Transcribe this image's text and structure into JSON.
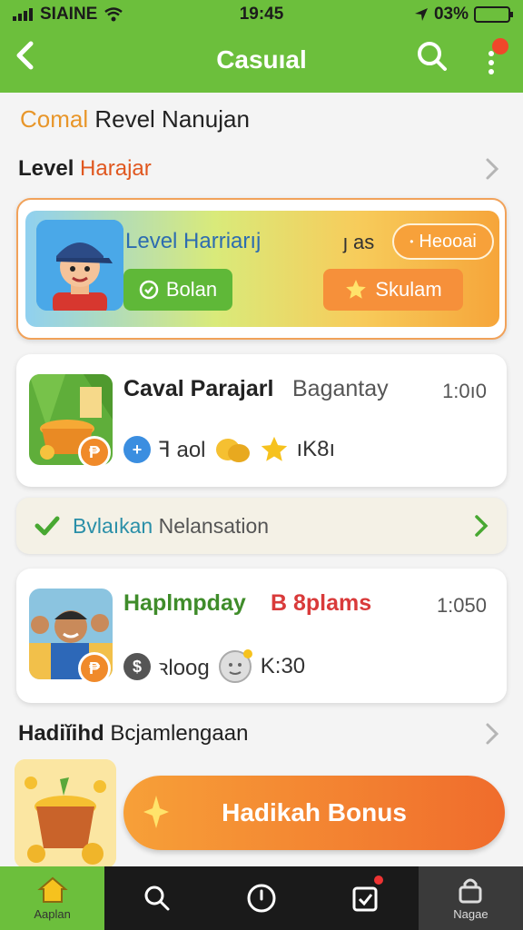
{
  "status": {
    "carrier": "SIAINE",
    "time": "19:45",
    "battery": "03%"
  },
  "header": {
    "title": "Casuıal"
  },
  "subtitle": {
    "highlight": "Comal",
    "rest": " Revel Nanujan"
  },
  "section1": {
    "bold": "Level ",
    "highlight": "Harajar"
  },
  "featured": {
    "title": "Level Harriarıj",
    "count": "ȷ as",
    "pill_label": "Heooai",
    "green_button": "Bolan",
    "orange_button": "Skulam"
  },
  "games": [
    {
      "title": "Caval Parajarl",
      "subtitle": "Bagantay",
      "time": "1:0ı0",
      "meta_text": "ꟻ aol",
      "meta_count": "ıK8ı"
    },
    {
      "title": "Haplmpday",
      "subtitle": "B 8plams",
      "time": "1:050",
      "meta_text": "ꝛloog",
      "meta_count": "K:30"
    }
  ],
  "notice": {
    "highlight": "Bvlaıkan",
    "rest": " Nelansation"
  },
  "section3": {
    "bold": "Hadiĭihd",
    "rest": " Bcjamlengaan"
  },
  "promo": {
    "label": "Hadikah Bonus"
  },
  "tabs": [
    {
      "label": "Aaplan"
    },
    {
      "label": ""
    },
    {
      "label": ""
    },
    {
      "label": ""
    },
    {
      "label": "Nagae"
    }
  ],
  "colors": {
    "primary": "#6cbf3c",
    "accent": "#f6903a",
    "dark_bar": "#1a1a1a"
  }
}
